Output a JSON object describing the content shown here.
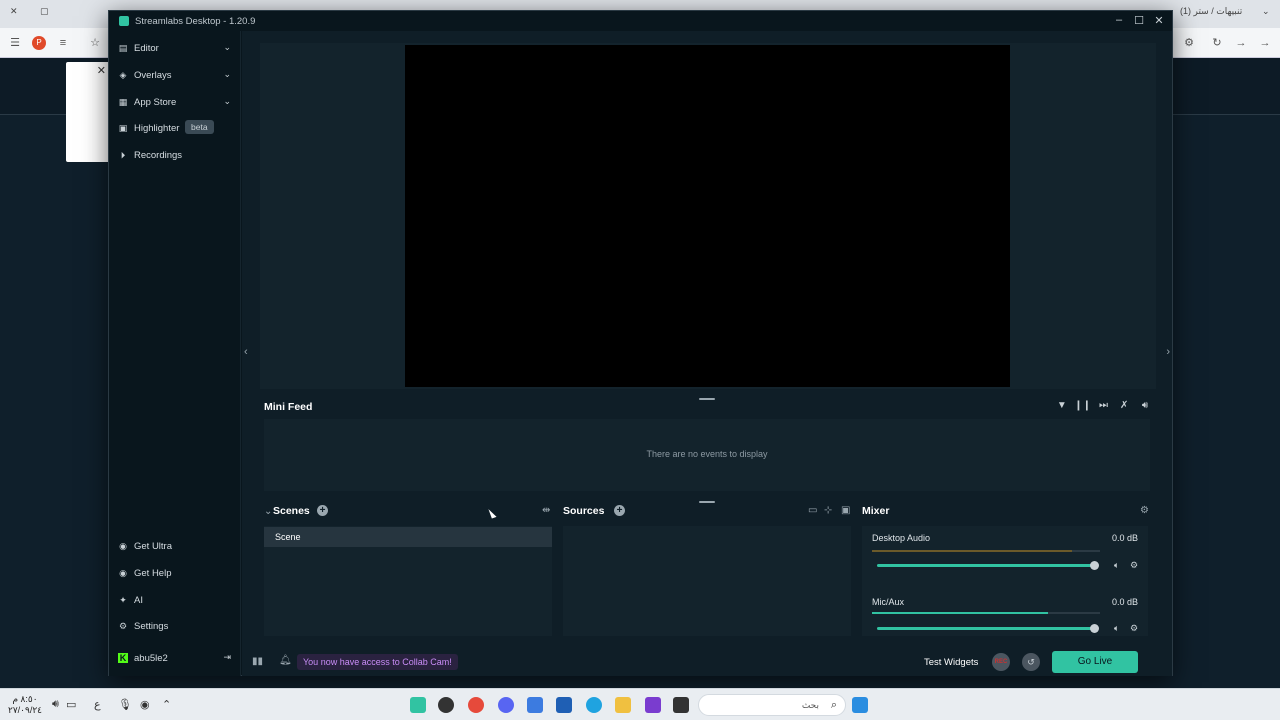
{
  "window": {
    "title": "Streamlabs Desktop - 1.20.9"
  },
  "browser_bg": {
    "tab_text": "(1) تنبيهات / ستر"
  },
  "sidebar": {
    "items": [
      {
        "label": "Editor",
        "icon": "editor-icon",
        "chevron": "⌄"
      },
      {
        "label": "Overlays",
        "icon": "overlays-icon",
        "chevron": "⌄"
      },
      {
        "label": "App Store",
        "icon": "app-store-icon",
        "chevron": "⌄"
      },
      {
        "label": "Highlighter",
        "icon": "highlighter-icon",
        "badge": "beta"
      },
      {
        "label": "Recordings",
        "icon": "recordings-icon"
      }
    ],
    "bottom_items": [
      {
        "label": "Get Ultra",
        "icon": "ultra-icon"
      },
      {
        "label": "Get Help",
        "icon": "help-icon"
      },
      {
        "label": "AI",
        "icon": "ai-icon"
      },
      {
        "label": "Settings",
        "icon": "gear-icon"
      }
    ],
    "user": {
      "name": "abu5le2",
      "logo_color": "#53fc18"
    }
  },
  "mini_feed": {
    "title": "Mini Feed",
    "empty_text": "There are no events to display"
  },
  "scenes": {
    "title": "Scenes",
    "items": [
      "Scene"
    ]
  },
  "sources": {
    "title": "Sources"
  },
  "mixer": {
    "title": "Mixer",
    "channels": [
      {
        "name": "Desktop Audio",
        "db": "0.0 dB"
      },
      {
        "name": "Mic/Aux",
        "db": "0.0 dB"
      }
    ]
  },
  "footer": {
    "notification": "You now have access to Collab Cam!",
    "test_widgets": "Test Widgets",
    "rec_label": "REC",
    "go_live": "Go Live"
  },
  "taskbar": {
    "time": "٨:٥٠ م",
    "date": "٢٧/٠٩/٢٤",
    "lang": "ع",
    "search_placeholder": "بحث"
  },
  "colors": {
    "accent": "#31c3a2",
    "background": "#09161d",
    "panel": "#13232c",
    "collab_text": "#c98df7"
  }
}
